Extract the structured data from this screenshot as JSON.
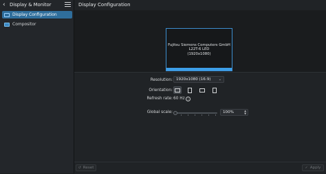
{
  "sidebar": {
    "title": "Display & Monitor",
    "items": [
      {
        "label": "Display Configuration",
        "icon": "display-icon",
        "active": true
      },
      {
        "label": "Compositor",
        "icon": "compositor-icon",
        "active": false
      }
    ]
  },
  "main": {
    "title": "Display Configuration"
  },
  "monitor": {
    "line1": "Fujitsu Siemens Computers GmbH",
    "line2": "L22T-6 LED",
    "line3": "(1920x1080)"
  },
  "settings": {
    "resolution_label": "Resolution:",
    "resolution_value": "1920x1080 (16:9)",
    "orientation_label": "Orientation:",
    "refresh_label": "Refresh rate:",
    "refresh_value": "60 Hz",
    "scale_label": "Global scale:",
    "scale_value": "100%",
    "scale_fraction": 0.0
  },
  "footer": {
    "reset_label": "Reset",
    "apply_label": "Apply"
  },
  "colors": {
    "accent": "#3d9ee8",
    "selection": "#2f6e9c",
    "background": "#202326"
  }
}
